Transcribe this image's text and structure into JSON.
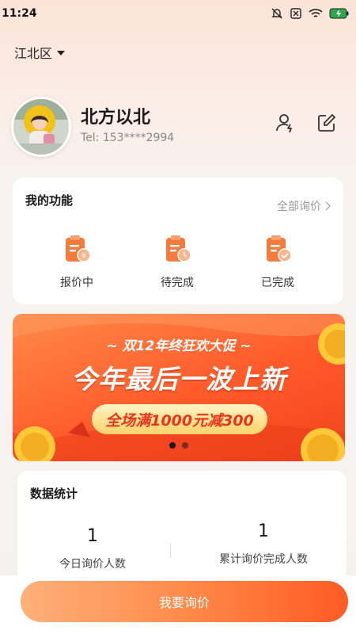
{
  "status_bar": {
    "time": "11:24"
  },
  "location": {
    "label": "江北区"
  },
  "profile": {
    "name": "北方以北",
    "phone": "Tel: 153****2994"
  },
  "functions": {
    "title": "我的功能",
    "all_link": "全部询价",
    "items": [
      {
        "label": "报价中",
        "icon": "clipboard-yen-icon"
      },
      {
        "label": "待完成",
        "icon": "clipboard-clock-icon"
      },
      {
        "label": "已完成",
        "icon": "clipboard-check-icon"
      }
    ]
  },
  "banner": {
    "subtitle": "~ 双12年终狂欢大促 ~",
    "headline": "今年最后一波上新",
    "pill": "全场满1000元减300",
    "page_count": 2,
    "active_page": 1
  },
  "stats": {
    "title": "数据统计",
    "items": [
      {
        "value": "1",
        "label": "今日询价人数"
      },
      {
        "value": "1",
        "label": "累计询价完成人数"
      }
    ]
  },
  "cta": {
    "label": "我要询价"
  },
  "colors": {
    "accent": "#ff6a2e",
    "accent_light": "#ffb07a",
    "icon_orange": "#f47b3c"
  }
}
